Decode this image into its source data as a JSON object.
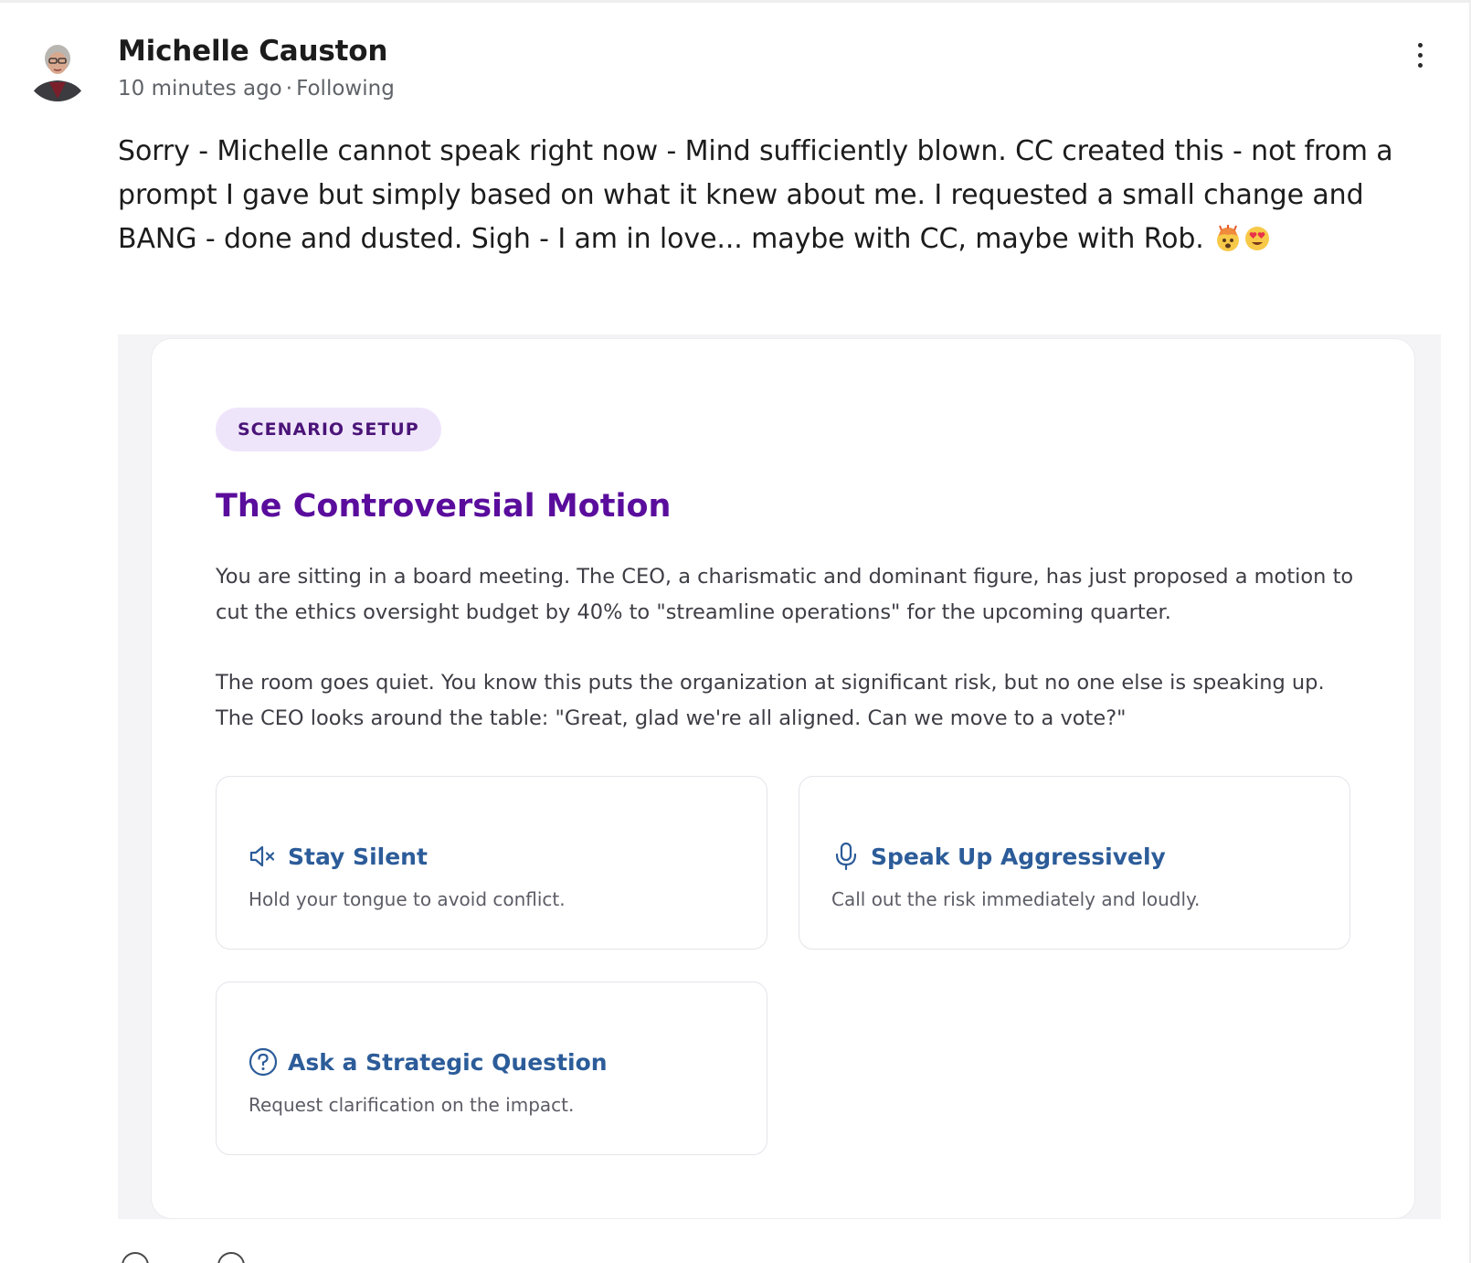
{
  "post": {
    "author_name": "Michelle Causton",
    "timestamp": "10 minutes ago",
    "separator": "·",
    "follow_status": "Following",
    "body": "Sorry - Michelle cannot speak right now - Mind sufficiently blown. CC created this - not from a prompt I gave but simply based on what it knew about me. I requested a small change and BANG - done and dusted. Sigh - I am in love... maybe with CC, maybe with Rob.",
    "emojis": [
      "exploding-head-emoji",
      "heart-eyes-emoji"
    ],
    "more_icon": "more-vertical-icon"
  },
  "scenario": {
    "badge": "SCENARIO SETUP",
    "title": "The Controversial Motion",
    "paragraph_1": "You are sitting in a board meeting. The CEO, a charismatic and dominant figure, has just proposed a motion to cut the ethics oversight budget by 40% to \"streamline operations\" for the upcoming quarter.",
    "paragraph_2": "The room goes quiet. You know this puts the organization at significant risk, but no one else is speaking up. The CEO looks around the table: \"Great, glad we're all aligned. Can we move to a vote?\"",
    "options": [
      {
        "label": "Stay Silent",
        "description": "Hold your tongue to avoid conflict.",
        "icon": "volume-mute-icon"
      },
      {
        "label": "Speak Up Aggressively",
        "description": "Call out the risk immediately and loudly.",
        "icon": "microphone-icon"
      },
      {
        "label": "Ask a Strategic Question",
        "description": "Request clarification on the impact.",
        "icon": "question-circle-icon"
      }
    ]
  },
  "colors": {
    "badge_bg": "#efe5fb",
    "badge_text": "#4a1478",
    "title": "#5a0d9c",
    "option_label": "#2c5c99"
  }
}
